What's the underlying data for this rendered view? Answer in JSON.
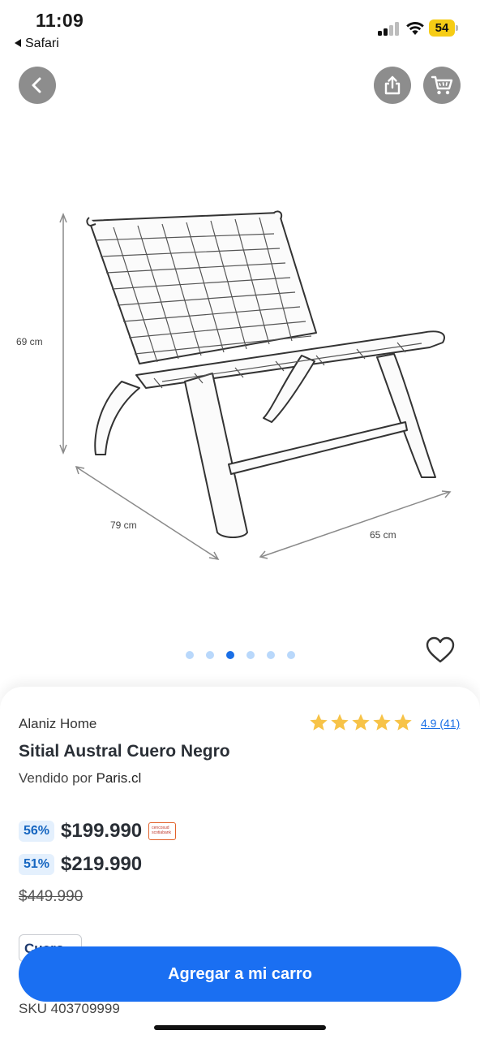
{
  "status_bar": {
    "time": "11:09",
    "back_app_label": "Safari",
    "battery_level": "54",
    "battery_color": "#f6cc15"
  },
  "header": {
    "back_icon": "chevron-left-icon",
    "share_icon": "share-icon",
    "cart_icon": "cart-icon"
  },
  "image": {
    "dimension_height": "69 cm",
    "dimension_depth": "79 cm",
    "dimension_width": "65 cm",
    "carousel_total": 6,
    "carousel_active_index": 2
  },
  "product": {
    "brand": "Alaniz Home",
    "rating_text": "4.9 (41)",
    "rating_value": 4.9,
    "rating_stars": 5,
    "title": "Sitial Austral Cuero Negro",
    "seller_prefix": "Vendido por",
    "seller_name": "Paris.cl",
    "prices": [
      {
        "discount": "56%",
        "amount": "$199.990",
        "card_badge": true
      },
      {
        "discount": "51%",
        "amount": "$219.990",
        "card_badge": false
      }
    ],
    "card_badge_text": "cencosud scotiabank",
    "old_price": "$449.990",
    "variant_chip": "Cuero",
    "sku": "SKU 403709999"
  },
  "actions": {
    "add_to_cart": "Agregar a mi carro"
  },
  "colors": {
    "accent": "#1a6ff2",
    "star": "#f7c348",
    "discount_bg": "#e4f0fd",
    "discount_text": "#1565c0"
  }
}
